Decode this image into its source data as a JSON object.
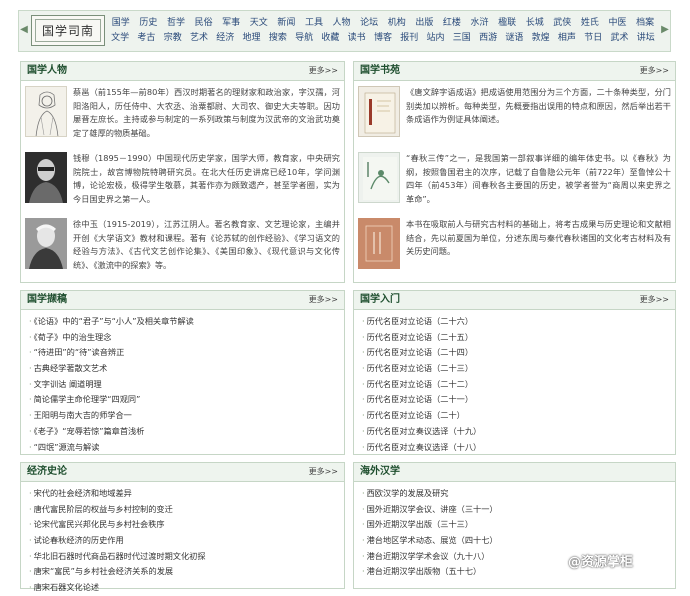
{
  "nav": {
    "logo_text": "国学司南",
    "row1": [
      "国学",
      "历史",
      "哲学",
      "民俗",
      "军事",
      "天文",
      "新闻",
      "工具",
      "人物",
      "论坛",
      "机构",
      "出版",
      "红楼",
      "水浒",
      "楹联",
      "长城",
      "武侠",
      "姓氏",
      "中医",
      "档案"
    ],
    "row2": [
      "文学",
      "考古",
      "宗教",
      "艺术",
      "经济",
      "地理",
      "搜索",
      "导航",
      "收藏",
      "读书",
      "博客",
      "报刊",
      "站内",
      "三国",
      "西游",
      "谜语",
      "敦煌",
      "相声",
      "节日",
      "武术",
      "讲坛"
    ]
  },
  "more_label": "更多>>",
  "renwu": {
    "title": "国学人物",
    "entries": [
      {
        "text": "蔡邕（前155年—前80年）西汉时期著名的理财家和政治家，字汉孺，河阳洛阳人，历任侍中、大农丞、治粟都尉、大司农、御史大夫等职。因功屡晋左庶长。主持或参与制定的一系列政策与制度为汉武帝的文治武功奠定了雄厚的物质基础。"
      },
      {
        "text": "钱穆（1895－1990）中国现代历史学家，国学大师，教育家，中央研究院院士，故宫博物院特聘研究员。在北大任历史讲席已经10年，学问渊博，论论宏极，极得学生敬慕，其著作亦为颇致遗产，甚至学者圈，实为今日国史界之第一人。"
      },
      {
        "text": "徐中玉（1915-2019），江苏江阴人。著名教育家、文艺理论家，主编并开创《大学语文》教材和课程。著有《论苏轼的创作经验》、《学习语文的经验与方法》、《古代文艺创作论集》、《美国印象》、《现代意识与文化传统》、《激流中的探索》等。"
      }
    ]
  },
  "shuyuan": {
    "title": "国学书苑",
    "entries": [
      {
        "text": "《唐文辞字语成语》把成语使用范围分为三个方面，二十条种类型，分门别类加以辨析。每种类型，先概要指出误用的特点和原因，然后举出若干条成语作为例证具体阐述。"
      },
      {
        "text": "“春秋三传”之一，是我国第一部叙事详细的编年体史书。以《春秋》为纲，按照鲁国君主的次序，记载了自鲁隐公元年（前722年）至鲁悼公十四年（前453年）间春秋各主要国的历史，被学者誉为“商周以来史界之革命”。"
      },
      {
        "text": "本书在吸取前人与研究古村料的基础上，将考古成果与历史理论和文献相结合，先以前夏国为单位，分述东周与秦代春秋诸国的文化考古材料及有关历史问题。"
      }
    ]
  },
  "gaoji": {
    "title": "国学撷稿",
    "items": [
      "《论语》中的“君子”与“小人”及相关章节解读",
      "《荀子》中的治生理念",
      "“待进田”的“待”读音辨正",
      "古典经学著散文艺术",
      "文字训诂 阐道明理",
      "简论儒学主命伦理学“四观同”",
      "王阳明与南大吉的师学合一",
      "《老子》“宠辱若惊”篇章首浅析",
      "“四氓”源流与解读"
    ]
  },
  "rumen": {
    "title": "国学入门",
    "items": [
      "历代名臣对立论语（二十六）",
      "历代名臣对立论语（二十五）",
      "历代名臣对立论语（二十四）",
      "历代名臣对立论语（二十三）",
      "历代名臣对立论语（二十二）",
      "历代名臣对立论语（二十一）",
      "历代名臣对立论语（二十）",
      "历代名臣对立奏议选译（十九）",
      "历代名臣对立奏议选译（十八）"
    ]
  },
  "jingji": {
    "title": "经济史论",
    "items": [
      "宋代的社会经济和地域差异",
      "唐代富民阶层的权益与乡村控制的变迁",
      "论宋代富民兴邦化民与乡村社会秩序",
      "试论春秋经济的历史作用",
      "华北旧石器时代商品石器时代过渡时期文化初探",
      "唐宋“富民”与乡村社会经济关系的发展",
      "唐宋石器文化论述"
    ]
  },
  "haiwai": {
    "title": "海外汉学",
    "items": [
      "西欧汉学的发展及研究",
      "国外近期汉学会议、讲座（三十一）",
      "国外近期汉学出版（三十三）",
      "港台地区学术动态、展览（四十七）",
      "港台近期汉学学术会议（九十八）",
      "港台近期汉学出版物（五十七）"
    ]
  },
  "watermark": "@资源掌柜"
}
